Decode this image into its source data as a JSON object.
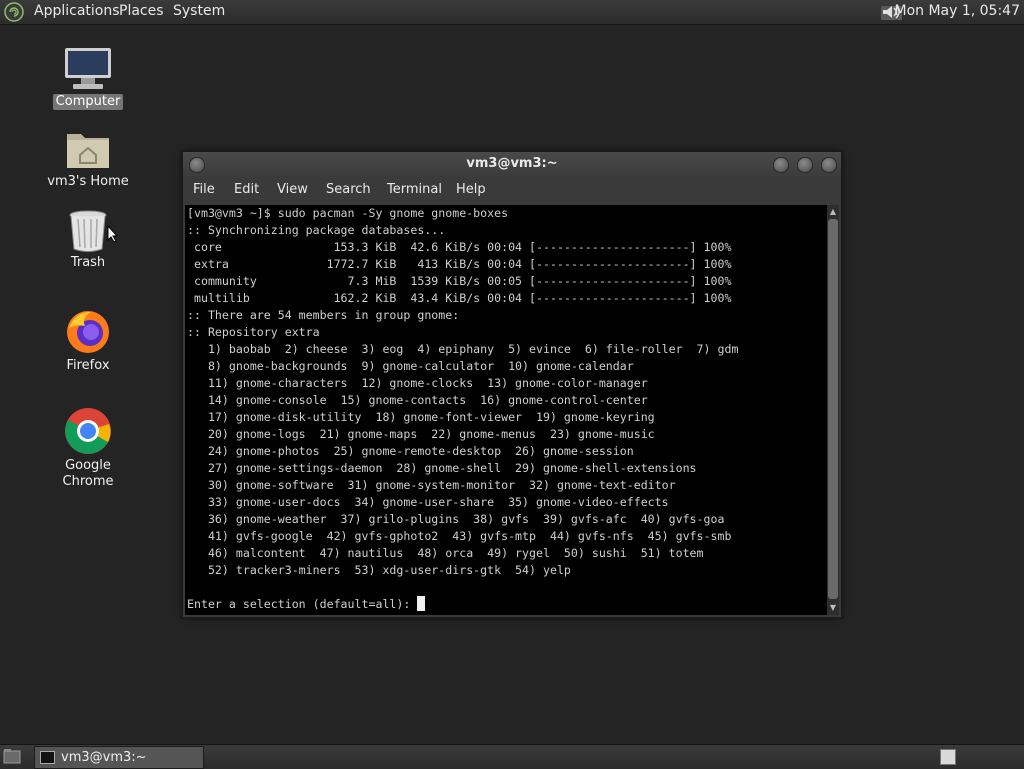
{
  "top_panel": {
    "menus": [
      "Applications",
      "Places",
      "System"
    ],
    "clock": "Mon May  1, 05:47"
  },
  "desktop_icons": [
    {
      "label": "Computer",
      "icon": "computer-icon"
    },
    {
      "label": "vm3's Home",
      "icon": "home-folder-icon"
    },
    {
      "label": "Trash",
      "icon": "trash-icon"
    },
    {
      "label": "Firefox",
      "icon": "firefox-icon"
    },
    {
      "label": "Google Chrome",
      "icon": "chrome-icon"
    }
  ],
  "terminal": {
    "title": "vm3@vm3:~",
    "menus": [
      "File",
      "Edit",
      "View",
      "Search",
      "Terminal",
      "Help"
    ],
    "lines": [
      "[vm3@vm3 ~]$ sudo pacman -Sy gnome gnome-boxes",
      ":: Synchronizing package databases...",
      " core                153.3 KiB  42.6 KiB/s 00:04 [----------------------] 100%",
      " extra              1772.7 KiB   413 KiB/s 00:04 [----------------------] 100%",
      " community             7.3 MiB  1539 KiB/s 00:05 [----------------------] 100%",
      " multilib            162.2 KiB  43.4 KiB/s 00:04 [----------------------] 100%",
      ":: There are 54 members in group gnome:",
      ":: Repository extra",
      "   1) baobab  2) cheese  3) eog  4) epiphany  5) evince  6) file-roller  7) gdm",
      "   8) gnome-backgrounds  9) gnome-calculator  10) gnome-calendar",
      "   11) gnome-characters  12) gnome-clocks  13) gnome-color-manager",
      "   14) gnome-console  15) gnome-contacts  16) gnome-control-center",
      "   17) gnome-disk-utility  18) gnome-font-viewer  19) gnome-keyring",
      "   20) gnome-logs  21) gnome-maps  22) gnome-menus  23) gnome-music",
      "   24) gnome-photos  25) gnome-remote-desktop  26) gnome-session",
      "   27) gnome-settings-daemon  28) gnome-shell  29) gnome-shell-extensions",
      "   30) gnome-software  31) gnome-system-monitor  32) gnome-text-editor",
      "   33) gnome-user-docs  34) gnome-user-share  35) gnome-video-effects",
      "   36) gnome-weather  37) grilo-plugins  38) gvfs  39) gvfs-afc  40) gvfs-goa",
      "   41) gvfs-google  42) gvfs-gphoto2  43) gvfs-mtp  44) gvfs-nfs  45) gvfs-smb",
      "   46) malcontent  47) nautilus  48) orca  49) rygel  50) sushi  51) totem",
      "   52) tracker3-miners  53) xdg-user-dirs-gtk  54) yelp",
      ""
    ],
    "prompt": "Enter a selection (default=all): "
  },
  "taskbar": {
    "task_label": "vm3@vm3:~"
  }
}
